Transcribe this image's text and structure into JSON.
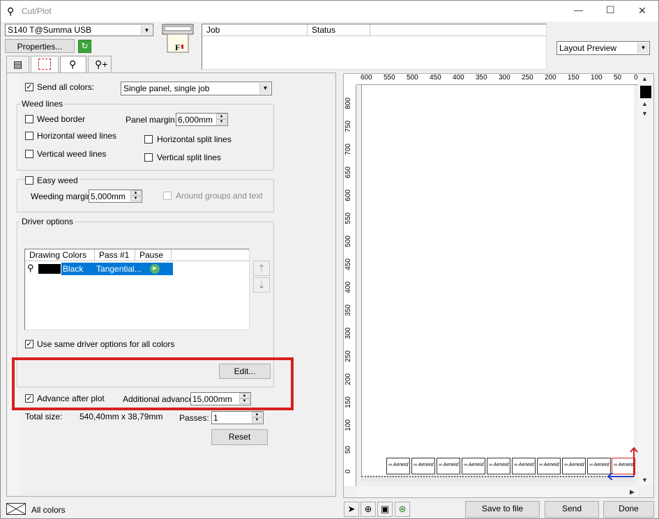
{
  "window": {
    "title": "Cut/Plot",
    "minimize": "—",
    "maximize": "☐",
    "close": "✕"
  },
  "device": {
    "selected": "S140 T@Summa USB",
    "properties_label": "Properties..."
  },
  "queue": {
    "col_job": "Job",
    "col_status": "Status"
  },
  "view": {
    "selected": "Layout Preview"
  },
  "send_all": {
    "label": "Send all colors:",
    "checked": "✓",
    "mode": "Single panel, single job"
  },
  "weed_lines": {
    "title": "Weed lines",
    "weed_border": "Weed border",
    "horizontal": "Horizontal weed lines",
    "vertical": "Vertical weed lines",
    "panel_margin_label": "Panel margin:",
    "panel_margin_value": "6,000mm",
    "h_split": "Horizontal split lines",
    "v_split": "Vertical split lines"
  },
  "easy_weed": {
    "label": "Easy weed",
    "margin_label": "Weeding margin:",
    "margin_value": "5,000mm",
    "around_groups": "Around groups and text"
  },
  "driver": {
    "title": "Driver options",
    "columns": [
      "Drawing Colors",
      "Pass #1",
      "Pause"
    ],
    "row": {
      "color_name": "Black",
      "pass1": "Tangential...",
      "color_hex": "#000000"
    },
    "same_options_label": "Use same driver options for all colors",
    "same_options_checked": "✓",
    "edit_label": "Edit..."
  },
  "advance": {
    "label": "Advance after plot",
    "checked": "✓",
    "additional_label": "Additional advance:",
    "additional_value": "15,000mm"
  },
  "totals": {
    "total_size_label": "Total size:",
    "total_size_value": "540,40mm x 38,79mm",
    "passes_label": "Passes:",
    "passes_value": "1",
    "reset_label": "Reset"
  },
  "preview": {
    "x_ticks": [
      "600",
      "550",
      "500",
      "450",
      "400",
      "350",
      "300",
      "250",
      "200",
      "150",
      "100",
      "50",
      "0"
    ],
    "y_ticks": [
      "800",
      "750",
      "700",
      "650",
      "600",
      "550",
      "500",
      "450",
      "400",
      "350",
      "300",
      "250",
      "200",
      "150",
      "100",
      "50",
      "0"
    ],
    "piece_text": "∞ Aeneid"
  },
  "footer": {
    "all_colors_label": "All colors",
    "save_label": "Save to file",
    "send_label": "Send",
    "done_label": "Done"
  },
  "colors": {
    "highlight": "#d9201f",
    "selection": "#0078d7",
    "axis_x": "#1f3fd0",
    "axis_y": "#d01f1f"
  }
}
